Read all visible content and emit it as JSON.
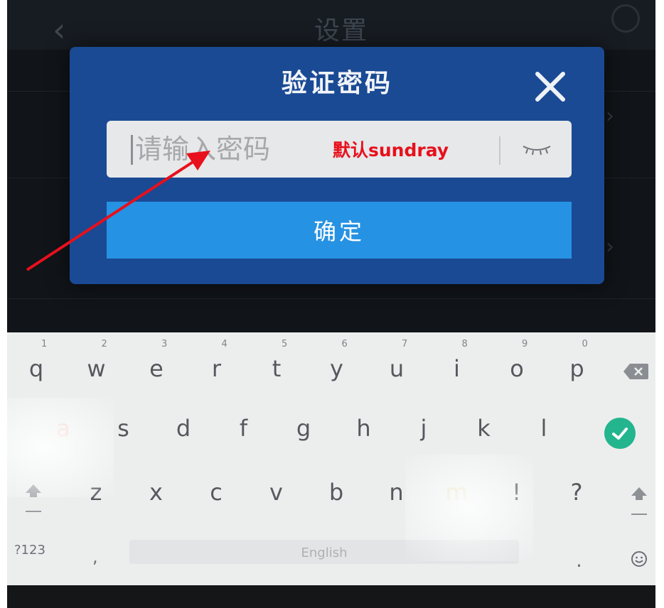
{
  "header": {
    "title": "设置"
  },
  "dialog": {
    "title": "验证密码",
    "password_placeholder": "请输入密码",
    "annotation": "默认sundray",
    "confirm_label": "确定"
  },
  "keyboard": {
    "row1": [
      {
        "key": "q",
        "hint": "1"
      },
      {
        "key": "w",
        "hint": "2"
      },
      {
        "key": "e",
        "hint": "3"
      },
      {
        "key": "r",
        "hint": "4"
      },
      {
        "key": "t",
        "hint": "5"
      },
      {
        "key": "y",
        "hint": "6"
      },
      {
        "key": "u",
        "hint": "7"
      },
      {
        "key": "i",
        "hint": "8"
      },
      {
        "key": "o",
        "hint": "9"
      },
      {
        "key": "p",
        "hint": "0"
      }
    ],
    "row2": [
      "a",
      "s",
      "d",
      "f",
      "g",
      "h",
      "j",
      "k",
      "l"
    ],
    "row3": [
      "z",
      "x",
      "c",
      "v",
      "b",
      "n",
      "m",
      "!",
      "?"
    ],
    "numbers_label": "?123",
    "comma": ",",
    "space_label": "English",
    "period": ".",
    "accent_color": "#22b58e"
  },
  "colors": {
    "dialog_bg": "#1a4a94",
    "confirm_bg": "#2692e3",
    "annotation": "#e8101c"
  }
}
